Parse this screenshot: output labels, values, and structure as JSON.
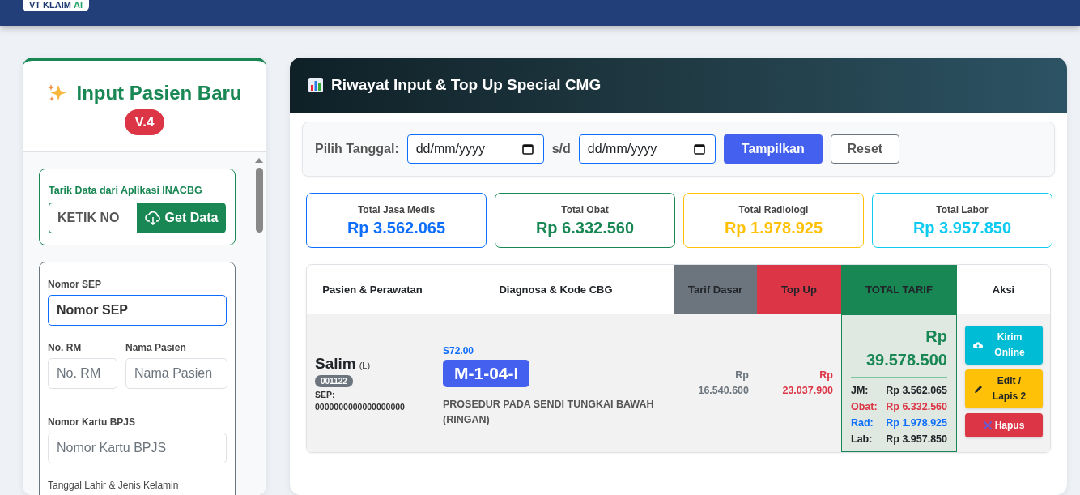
{
  "header": {
    "logo": {
      "text": "VT KLAIM",
      "accent": "AI"
    }
  },
  "left_panel": {
    "title": "Input Pasien Baru",
    "version": "V.4",
    "fetch": {
      "label": "Tarik Data dari Aplikasi INACBG",
      "input_placeholder": "KETIK NO",
      "button": "Get Data"
    },
    "form": {
      "sep": {
        "label": "Nomor SEP",
        "placeholder": "Nomor SEP",
        "focused": true
      },
      "rm": {
        "label": "No. RM",
        "placeholder": "No. RM",
        "focused": false
      },
      "name": {
        "label": "Nama Pasien",
        "placeholder": "Nama Pasien",
        "focused": false
      },
      "bpjs": {
        "label": "Nomor Kartu BPJS",
        "placeholder": "Nomor Kartu BPJS",
        "focused": false
      },
      "birth_gender_label": "Tanggal Lahir & Jenis Kelamin"
    }
  },
  "right_panel": {
    "title": "Riwayat Input & Top Up Special CMG",
    "filter": {
      "label": "Pilih Tanggal:",
      "from_placeholder": "dd/mm/yyyy",
      "separator": "s/d",
      "to_placeholder": "dd/mm/yyyy",
      "buttons": [
        {
          "label": "Tampilkan",
          "kind": "primary"
        },
        {
          "label": "Reset",
          "kind": "outline"
        }
      ]
    },
    "stats": [
      {
        "label": "Total Jasa Medis",
        "value": "Rp 3.562.065",
        "color": "#0d6efd"
      },
      {
        "label": "Total Obat",
        "value": "Rp 6.332.560",
        "color": "#198754"
      },
      {
        "label": "Total Radiologi",
        "value": "Rp 1.978.925",
        "color": "#ffc107"
      },
      {
        "label": "Total Labor",
        "value": "Rp 3.957.850",
        "color": "#0dcaf0"
      }
    ],
    "table": {
      "columns": [
        {
          "label": "Pasien & Perawatan"
        },
        {
          "label": "Diagnosa & Kode CBG"
        },
        {
          "label": "Tarif Dasar",
          "color": "#6c757d"
        },
        {
          "label": "Top Up",
          "color": "#dc3545"
        },
        {
          "label": "TOTAL TARIF",
          "color": "#198754"
        },
        {
          "label": "Aksi"
        }
      ],
      "rows": [
        {
          "name": "Salim",
          "gender": "(L)",
          "rm": "001122",
          "sep_label": "SEP:",
          "sep": "0000000000000000000",
          "diagnosis_code": "S72.00",
          "cbg": "M-1-04-I",
          "description": "PROSEDUR PADA SENDI TUNGKAI BAWAH (RINGAN)",
          "tarif_dasar": "Rp 16.540.600",
          "top_up": "Rp 23.037.900",
          "total": "Rp 39.578.500",
          "breakdown": [
            {
              "label": "JM:",
              "value": "Rp 3.562.065",
              "color": "#212529"
            },
            {
              "label": "Obat:",
              "value": "Rp 6.332.560",
              "color": "#dc3545"
            },
            {
              "label": "Rad:",
              "value": "Rp 1.978.925",
              "color": "#0d6efd"
            },
            {
              "label": "Lab:",
              "value": "Rp 3.957.850",
              "color": "#212529"
            }
          ],
          "actions": [
            {
              "label": "Kirim Online",
              "kind": "send"
            },
            {
              "label": "Edit / Lapis 2",
              "kind": "edit"
            },
            {
              "label": "Hapus",
              "kind": "delete"
            }
          ]
        }
      ]
    }
  }
}
